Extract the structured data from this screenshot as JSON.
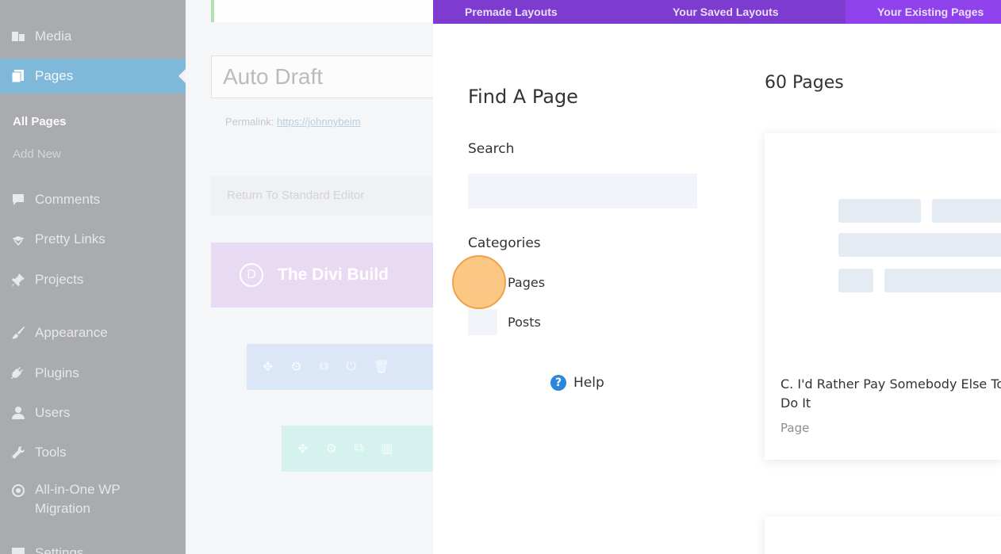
{
  "sidebar": {
    "items": [
      {
        "label": "Media",
        "icon": "media-icon"
      },
      {
        "label": "Pages",
        "icon": "pages-icon",
        "active": true
      },
      {
        "label": "Comments",
        "icon": "comments-icon"
      },
      {
        "label": "Pretty Links",
        "icon": "pretty-links-icon"
      },
      {
        "label": "Projects",
        "icon": "projects-icon"
      },
      {
        "label": "Appearance",
        "icon": "appearance-icon"
      },
      {
        "label": "Plugins",
        "icon": "plugins-icon"
      },
      {
        "label": "Users",
        "icon": "users-icon"
      },
      {
        "label": "Tools",
        "icon": "tools-icon"
      },
      {
        "label": "All-in-One WP",
        "label2": "Migration",
        "icon": "migration-icon"
      },
      {
        "label": "Settings",
        "icon": "settings-icon"
      }
    ],
    "sub_items": [
      {
        "label": "All Pages",
        "current": true
      },
      {
        "label": "Add New"
      }
    ]
  },
  "editor": {
    "title_value": "Auto Draft",
    "permalink_label": "Permalink:",
    "permalink_url": "https://johnnybeim",
    "return_button": "Return To Standard Editor",
    "builder_title": "The Divi Build",
    "builder_logo": "D"
  },
  "modal": {
    "tabs": [
      {
        "label": "Premade Layouts"
      },
      {
        "label": "Your Saved Layouts"
      },
      {
        "label": "Your Existing Pages",
        "active": true
      }
    ],
    "find_title": "Find A Page",
    "search_label": "Search",
    "search_placeholder": "",
    "categories_label": "Categories",
    "categories": [
      {
        "label": "Pages"
      },
      {
        "label": "Posts"
      }
    ],
    "help_label": "Help",
    "pages_count": "60 Pages",
    "cards": [
      {
        "title": "C. I'd Rather Pay Somebody Else To Do It",
        "type": "Page"
      }
    ]
  },
  "colors": {
    "sidebar_bg": "#a9abae",
    "active_menu": "#7fb8d9",
    "modal_tab_bar": "#7e3bd0",
    "modal_tab_active": "#8f42ec",
    "help_icon": "#2b87da",
    "click_marker": "#fabe6e"
  }
}
